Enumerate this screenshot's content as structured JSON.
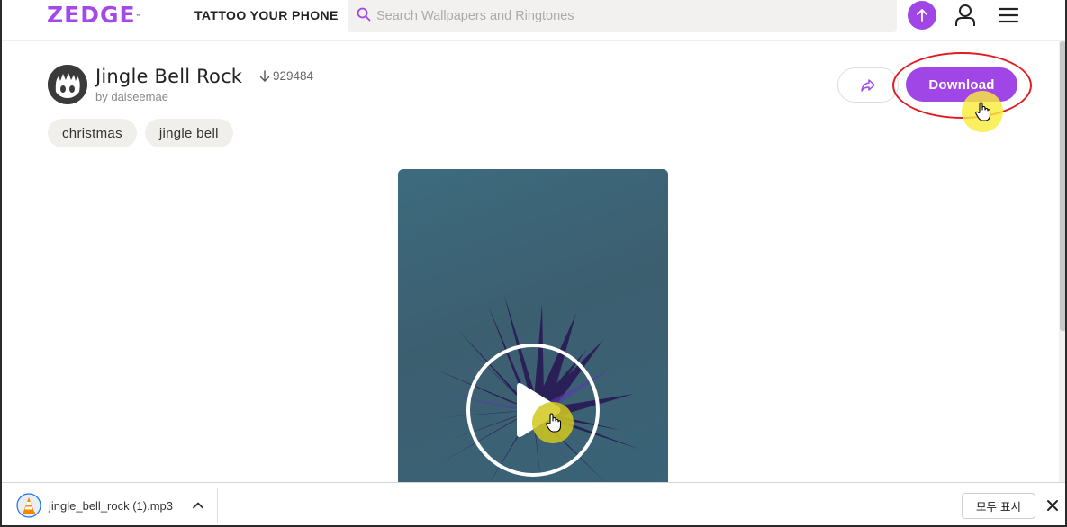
{
  "header": {
    "logo": "ZEDGE",
    "logo_tm": "™",
    "tagline": "TATTOO YOUR PHONE",
    "search_placeholder": "Search Wallpapers and Ringtones"
  },
  "item": {
    "title": "Jingle Bell Rock",
    "download_count": "929484",
    "author": "by daiseemae",
    "tags": [
      "christmas",
      "jingle bell"
    ],
    "download_label": "Download"
  },
  "download_bar": {
    "filename": "jingle_bell_rock (1).mp3",
    "show_all_label": "모두 표시"
  },
  "colors": {
    "brand": "#a046e6",
    "annotation": "#e01c22",
    "cursor_highlight": "#f8ec3c",
    "preview_bg": "#3d6b7e"
  },
  "icons": [
    "search-icon",
    "arrow-up-icon",
    "user-icon",
    "hamburger-menu-icon",
    "download-arrow-icon",
    "share-icon",
    "play-icon",
    "vlc-cone-icon",
    "chevron-up-icon",
    "close-icon",
    "hand-cursor-icon"
  ]
}
